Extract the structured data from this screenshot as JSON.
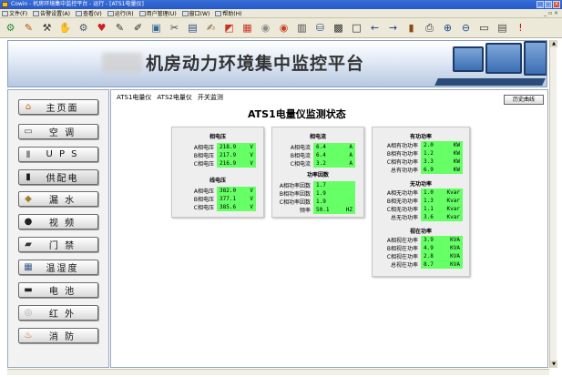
{
  "window": {
    "title": "Cowin - 机房环境集中监控平台 - 运行 - [ATS1电量仪]"
  },
  "menu": [
    {
      "label": "文件(F)",
      "icon": "file-icon"
    },
    {
      "label": "告警设置(A)",
      "icon": "alarm-icon"
    },
    {
      "label": "查看(V)",
      "icon": "view-icon"
    },
    {
      "label": "运行(R)",
      "icon": "run-icon"
    },
    {
      "label": "用户管理(U)",
      "icon": "user-icon"
    },
    {
      "label": "窗口(W)",
      "icon": "window-icon"
    },
    {
      "label": "帮助(H)",
      "icon": "help-icon"
    }
  ],
  "toolbar": [
    {
      "icon": "plugin-icon",
      "glyph": "⚙",
      "color": "#2a8a3a"
    },
    {
      "icon": "user-tool-icon",
      "glyph": "✎",
      "color": "#c05010"
    },
    {
      "icon": "hammer-icon",
      "glyph": "⚒",
      "color": "#333333"
    },
    {
      "icon": "handshake-icon",
      "glyph": "✋",
      "color": "#a05020"
    },
    {
      "icon": "tools-icon",
      "glyph": "⚙",
      "color": "#4a5a70"
    },
    {
      "icon": "heart-icon",
      "glyph": "♥",
      "color": "#cc2020"
    },
    {
      "icon": "edit-icon",
      "glyph": "✎",
      "color": "#333333"
    },
    {
      "icon": "pen-icon",
      "glyph": "✐",
      "color": "#222222"
    },
    {
      "icon": "image-icon",
      "glyph": "▣",
      "color": "#3a6a9a"
    },
    {
      "icon": "cut-icon",
      "glyph": "✂",
      "color": "#444444"
    },
    {
      "icon": "chart-icon",
      "glyph": "▤",
      "color": "#2a4a8a"
    },
    {
      "icon": "brush-icon",
      "glyph": "✍",
      "color": "#885522"
    },
    {
      "icon": "toggle-icon",
      "glyph": "◩",
      "color": "#cc3020"
    },
    {
      "icon": "grid-icon",
      "glyph": "▦",
      "color": "#cc3020"
    },
    {
      "icon": "alarm-bell-icon",
      "glyph": "◉",
      "color": "#8a8a8a"
    },
    {
      "icon": "alert-icon",
      "glyph": "◉",
      "color": "#cc4020"
    },
    {
      "icon": "table-icon",
      "glyph": "▥",
      "color": "#444444"
    },
    {
      "icon": "network-icon",
      "glyph": "⛁",
      "color": "#3a5a8a"
    },
    {
      "icon": "monitor-icon",
      "glyph": "▩",
      "color": "#333333"
    },
    {
      "icon": "square-icon",
      "glyph": "□",
      "color": "#222222"
    },
    {
      "icon": "arrow-left-icon",
      "glyph": "←",
      "color": "#1a3a8a"
    },
    {
      "icon": "arrow-right-icon",
      "glyph": "→",
      "color": "#1a3a8a"
    },
    {
      "icon": "books-icon",
      "glyph": "▮",
      "color": "#8a4a1a"
    },
    {
      "icon": "print-icon",
      "glyph": "⎙",
      "color": "#333333"
    },
    {
      "icon": "zoom-in-icon",
      "glyph": "⊕",
      "color": "#1a4a8a"
    },
    {
      "icon": "zoom-out-icon",
      "glyph": "⊖",
      "color": "#1a4a8a"
    },
    {
      "icon": "screen-icon",
      "glyph": "▭",
      "color": "#2a2a2a"
    },
    {
      "icon": "report-icon",
      "glyph": "▤",
      "color": "#4a4a4a"
    },
    {
      "icon": "exit-icon",
      "glyph": "!",
      "color": "#cc1010"
    }
  ],
  "banner": {
    "title": "机房动力环境集中监控平台"
  },
  "sidebar": {
    "items": [
      {
        "label": "主页面",
        "icon": "home-icon",
        "glyph": "⌂",
        "color": "#c46a1a"
      },
      {
        "label": "空 调",
        "icon": "air-conditioner-icon",
        "glyph": "▭",
        "color": "#555555"
      },
      {
        "label": "U P S",
        "icon": "ups-icon",
        "glyph": "▮",
        "color": "#8a8a8a"
      },
      {
        "label": "供配电",
        "icon": "power-distribution-icon",
        "glyph": "▮",
        "color": "#1a1a1a"
      },
      {
        "label": "漏 水",
        "icon": "water-leak-icon",
        "glyph": "◆",
        "color": "#a08030"
      },
      {
        "label": "视 频",
        "icon": "video-icon",
        "glyph": "●",
        "color": "#222222"
      },
      {
        "label": "门 禁",
        "icon": "access-control-icon",
        "glyph": "▰",
        "color": "#333333"
      },
      {
        "label": "温湿度",
        "icon": "temp-humidity-icon",
        "glyph": "▦",
        "color": "#3a5a8a"
      },
      {
        "label": "电 池",
        "icon": "battery-icon",
        "glyph": "▬",
        "color": "#222222"
      },
      {
        "label": "红 外",
        "icon": "infrared-icon",
        "glyph": "◎",
        "color": "#aaaaaa"
      },
      {
        "label": "消 防",
        "icon": "fire-icon",
        "glyph": "♨",
        "color": "#e05010"
      }
    ]
  },
  "tabs": [
    "ATS1电量仪",
    "ATS2电量仪",
    "开关监测"
  ],
  "history_button": "历史曲线",
  "heading": "ATS1电量仪监测状态",
  "panels": {
    "phase_voltage": {
      "title": "相电压",
      "rows": [
        {
          "label": "A相电压",
          "value": "218.9",
          "unit": "V"
        },
        {
          "label": "B相电压",
          "value": "217.9",
          "unit": "V"
        },
        {
          "label": "C相电压",
          "value": "216.9",
          "unit": "V"
        }
      ]
    },
    "line_voltage": {
      "title": "线电压",
      "rows": [
        {
          "label": "A相电压",
          "value": "382.0",
          "unit": "V"
        },
        {
          "label": "B相电压",
          "value": "377.1",
          "unit": "V"
        },
        {
          "label": "C相电压",
          "value": "385.6",
          "unit": "V"
        }
      ]
    },
    "phase_current": {
      "title": "相电流",
      "rows": [
        {
          "label": "A相电流",
          "value": "6.4",
          "unit": "A"
        },
        {
          "label": "B相电流",
          "value": "6.4",
          "unit": "A"
        },
        {
          "label": "C相电流",
          "value": "3.2",
          "unit": "A"
        }
      ]
    },
    "power_factor": {
      "title": "功率因数",
      "rows": [
        {
          "label": "A相功率因数",
          "value": "1.7",
          "unit": ""
        },
        {
          "label": "B相功率因数",
          "value": "1.9",
          "unit": ""
        },
        {
          "label": "C相功率因数",
          "value": "1.9",
          "unit": ""
        },
        {
          "label": "频率",
          "value": "50.1",
          "unit": "HZ"
        }
      ]
    },
    "active_power": {
      "title": "有功功率",
      "rows": [
        {
          "label": "A相有功功率",
          "value": "2.0",
          "unit": "KW"
        },
        {
          "label": "B相有功功率",
          "value": "1.2",
          "unit": "KW"
        },
        {
          "label": "C相有功功率",
          "value": "3.3",
          "unit": "KW"
        },
        {
          "label": "总有功功率",
          "value": "6.9",
          "unit": "KW"
        }
      ]
    },
    "reactive_power": {
      "title": "无功功率",
      "rows": [
        {
          "label": "A相无功功率",
          "value": "1.0",
          "unit": "Kvar"
        },
        {
          "label": "B相无功功率",
          "value": "1.3",
          "unit": "Kvar"
        },
        {
          "label": "C相无功功率",
          "value": "1.1",
          "unit": "Kvar"
        },
        {
          "label": "总无功功率",
          "value": "3.6",
          "unit": "Kvar"
        }
      ]
    },
    "apparent_power": {
      "title": "视在功率",
      "rows": [
        {
          "label": "A相视在功率",
          "value": "3.9",
          "unit": "KVA"
        },
        {
          "label": "B相视在功率",
          "value": "4.9",
          "unit": "KVA"
        },
        {
          "label": "C相视在功率",
          "value": "2.8",
          "unit": "KVA"
        },
        {
          "label": "总视在功率",
          "value": "8.7",
          "unit": "KVA"
        }
      ]
    }
  }
}
